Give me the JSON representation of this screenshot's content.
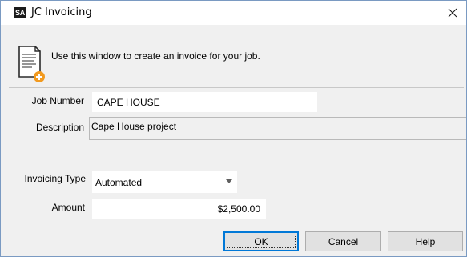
{
  "window": {
    "app_logo": "SA",
    "title": "JC Invoicing",
    "close_glyph": "✕"
  },
  "info": {
    "text": "Use this window to create an invoice for your job.",
    "icon": "invoice-document-add-icon"
  },
  "form": {
    "job_number": {
      "label": "Job Number",
      "value": "CAPE HOUSE"
    },
    "description": {
      "label": "Description",
      "value": "Cape House project"
    },
    "invoicing_type": {
      "label": "Invoicing Type",
      "value": "Automated"
    },
    "amount": {
      "label": "Amount",
      "value": "$2,500.00"
    }
  },
  "buttons": {
    "ok": "OK",
    "cancel": "Cancel",
    "help": "Help"
  },
  "colors": {
    "accent": "#0078d7",
    "icon_badge": "#f29a1f"
  }
}
